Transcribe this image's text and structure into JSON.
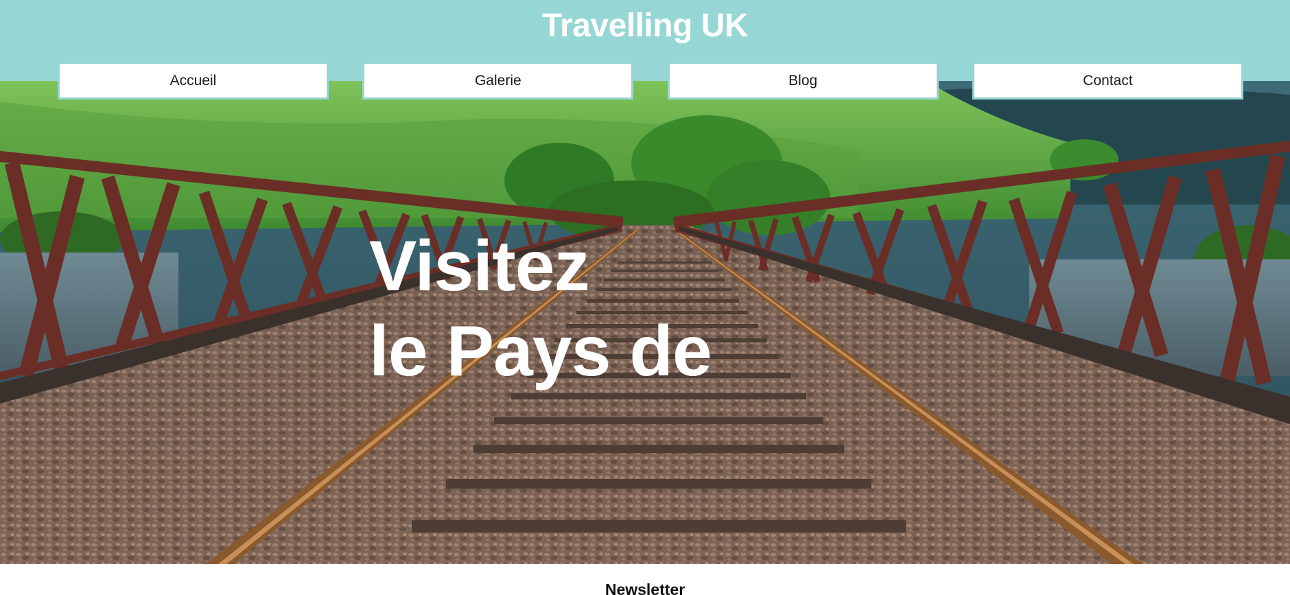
{
  "header": {
    "title": "Travelling UK"
  },
  "nav": {
    "items": [
      {
        "label": "Accueil"
      },
      {
        "label": "Galerie"
      },
      {
        "label": "Blog"
      },
      {
        "label": "Contact"
      }
    ]
  },
  "hero": {
    "headline_line1": "Visitez",
    "headline_line2": "le Pays de",
    "image_subject": "railway-bridge-landscape"
  },
  "newsletter": {
    "title": "Newsletter"
  },
  "colors": {
    "header_bg": "#96d6d4",
    "title_text": "#ffffff",
    "nav_bg": "#ffffff"
  }
}
